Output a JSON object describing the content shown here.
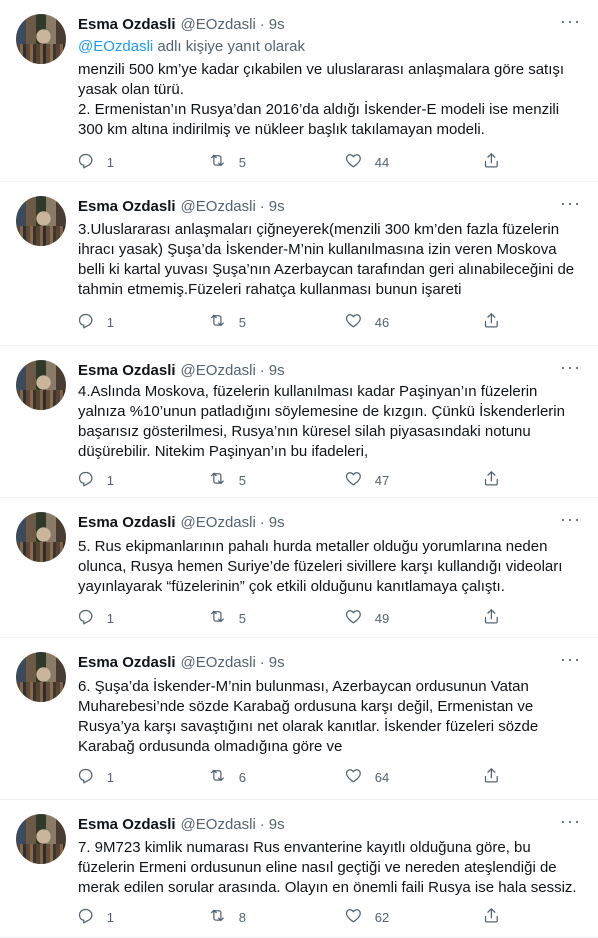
{
  "author": {
    "name": "Esma Ozdasli",
    "handle": "@EOzdasli",
    "dot": "·",
    "time": "9s"
  },
  "replying": {
    "mention": "@EOzdasli",
    "suffix": " adlı kişiye yanıt olarak"
  },
  "more_glyph": "···",
  "icons": {
    "reply": "reply-icon",
    "retweet": "retweet-icon",
    "like": "heart-icon",
    "share": "share-icon",
    "more": "more-icon"
  },
  "colors": {
    "text": "#0f1419",
    "secondary": "#536471",
    "link": "#1d9bf0",
    "divider": "#eff3f4"
  },
  "tweets": [
    {
      "lines": [
        "menzili 500 km’ye kadar çıkabilen ve uluslararası anlaşmalara göre satışı yasak olan türü.",
        "2. Ermenistan’ın Rusya’dan 2016’da aldığı İskender-E modeli ise menzili 300 km altına indirilmiş ve nükleer başlık takılamayan modeli."
      ],
      "replies": "1",
      "retweets": "5",
      "likes": "44"
    },
    {
      "lines": [
        "3.Uluslararası anlaşmaları çiğneyerek(menzili 300 km’den fazla füzelerin ihracı yasak) Şuşa’da İskender-M’nin kullanılmasına izin veren Moskova belli ki kartal yuvası Şuşa’nın Azerbaycan tarafından geri alınabileceğini de tahmin etmemiş.Füzeleri rahatça kullanması bunun işareti"
      ],
      "replies": "1",
      "retweets": "5",
      "likes": "46"
    },
    {
      "lines": [
        "4.Aslında Moskova, füzelerin kullanılması kadar Paşinyan’ın füzelerin yalnıza %10’unun patladığını söylemesine de kızgın. Çünkü İskenderlerin başarısız gösterilmesi, Rusya’nın küresel silah piyasasındaki notunu düşürebilir. Nitekim Paşinyan’ın bu ifadeleri,"
      ],
      "replies": "1",
      "retweets": "5",
      "likes": "47"
    },
    {
      "lines": [
        "5. Rus ekipmanlarının pahalı hurda metaller olduğu yorumlarına neden olunca, Rusya hemen Suriye’de füzeleri sivillere karşı kullandığı videoları yayınlayarak “füzelerinin” çok etkili olduğunu kanıtlamaya çalıştı."
      ],
      "replies": "1",
      "retweets": "5",
      "likes": "49"
    },
    {
      "lines": [
        "6. Şuşa’da İskender-M’nin bulunması, Azerbaycan ordusunun Vatan Muharebesi’nde sözde Karabağ ordusuna karşı değil, Ermenistan ve Rusya’ya karşı savaştığını net olarak kanıtlar.  İskender füzeleri sözde Karabağ ordusunda olmadığına göre ve"
      ],
      "replies": "1",
      "retweets": "6",
      "likes": "64"
    },
    {
      "lines": [
        "7. 9M723 kimlik numarası Rus envanterine kayıtlı olduğuna göre, bu füzelerin Ermeni ordusunun eline nasıl geçtiği ve nereden ateşlendiği de merak edilen sorular arasında. Olayın en önemli faili Rusya ise hala sessiz."
      ],
      "replies": "1",
      "retweets": "8",
      "likes": "62"
    }
  ]
}
